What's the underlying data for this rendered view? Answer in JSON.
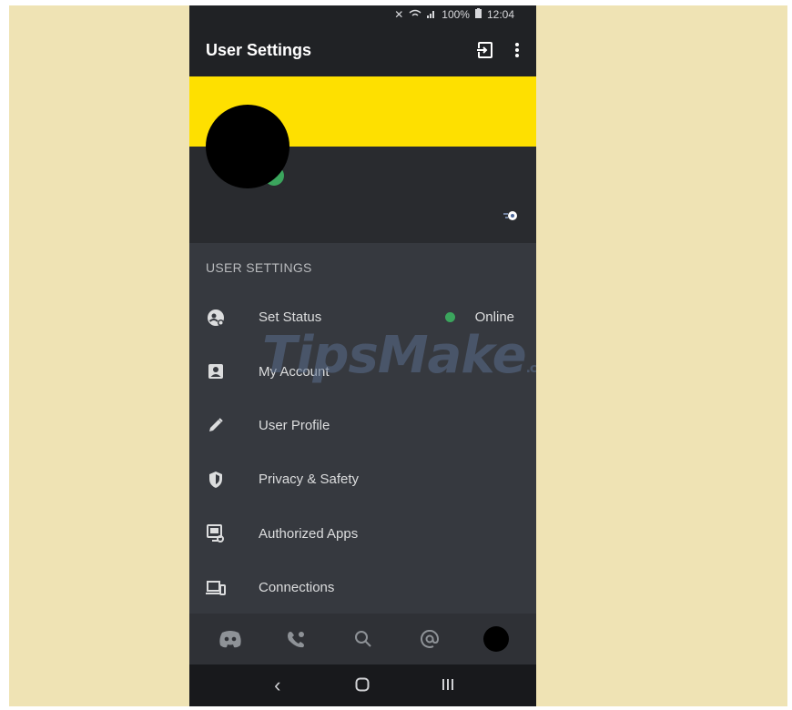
{
  "status_bar": {
    "battery": "100%",
    "time": "12:04"
  },
  "header": {
    "title": "User Settings"
  },
  "section": {
    "title": "USER SETTINGS"
  },
  "menu": [
    {
      "label": "Set Status",
      "value": "Online",
      "icon": "set-status-icon"
    },
    {
      "label": "My Account",
      "icon": "account-icon"
    },
    {
      "label": "User Profile",
      "icon": "pencil-icon"
    },
    {
      "label": "Privacy & Safety",
      "icon": "shield-icon"
    },
    {
      "label": "Authorized Apps",
      "icon": "apps-icon"
    },
    {
      "label": "Connections",
      "icon": "devices-icon"
    }
  ],
  "watermark": {
    "text": "TipsMake",
    "suffix": ".com"
  },
  "colors": {
    "banner": "#fee000",
    "online": "#3ba55d",
    "background": "#36393f",
    "page_bg": "#efe3b4"
  }
}
